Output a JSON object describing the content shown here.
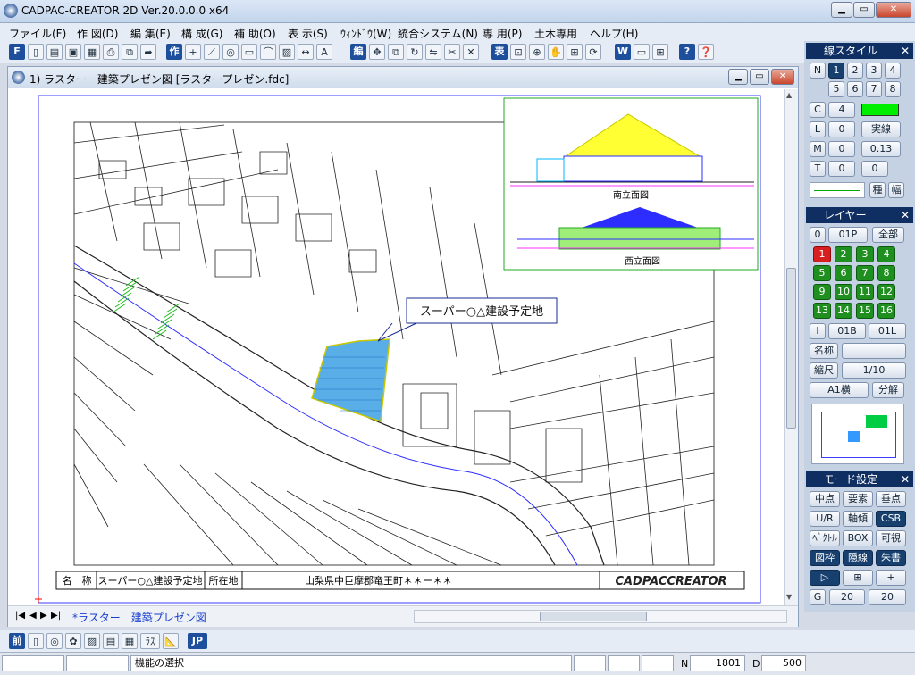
{
  "app": {
    "title": "CADPAC-CREATOR 2D Ver.20.0.0.0 x64"
  },
  "menu": [
    "ファイル(F)",
    "作 図(D)",
    "編 集(E)",
    "構 成(G)",
    "補 助(O)",
    "表 示(S)",
    "ｳｨﾝﾄﾞｳ(W)",
    "統合システム(N)",
    "専 用(P)",
    "土木専用",
    "ヘルプ(H)"
  ],
  "toolbar": {
    "btn_f": "F",
    "btn_saku": "作",
    "btn_hen": "編",
    "btn_hyo": "表",
    "btn_w": "W",
    "btn_help": "?"
  },
  "document": {
    "title": "1) ラスター　建築プレゼン図 [ラスタープレゼン.fdc]",
    "callout": "スーパー○△建設予定地",
    "elev_south": "南立面図",
    "elev_west": "西立面図",
    "table": {
      "label1": "名　称",
      "value1": "スーパー○△建設予定地",
      "label2": "所在地",
      "value2": "山梨県中巨摩郡竜王町＊＊ー＊＊"
    },
    "brand": "CADPACCREATOR",
    "tab": "*ラスター　建築プレゼン図"
  },
  "line_style": {
    "title": "線スタイル",
    "n_buttons": [
      "N",
      "1",
      "2",
      "3",
      "4",
      "5",
      "6",
      "7",
      "8"
    ],
    "c_label": "C",
    "c_value": "4",
    "l_label": "L",
    "l_value": "0",
    "l_type": "実線",
    "w_label": "M",
    "w_value": "0",
    "w_width": "0.13",
    "t_label": "T",
    "t_value": "0",
    "t_value2": "0",
    "btn_type": "種",
    "btn_width": "幅",
    "color_swatch": "#00ee00"
  },
  "layer": {
    "title": "レイヤー",
    "o_label": "0",
    "page": "01P",
    "all": "全部",
    "layers": [
      "1",
      "2",
      "3",
      "4",
      "5",
      "6",
      "7",
      "8",
      "9",
      "10",
      "11",
      "12",
      "13",
      "14",
      "15",
      "16"
    ],
    "i_label": "I",
    "block": "01B",
    "layer_cur": "01L",
    "name_label": "名称",
    "scale_label": "縮尺",
    "scale_value": "1/10",
    "paper": "A1横",
    "split": "分解"
  },
  "mode": {
    "title": "モード設定",
    "buttons": [
      "中点",
      "要素",
      "垂点",
      "U/R",
      "軸傾",
      "CSB",
      "ﾍﾞｸﾄﾙ",
      "BOX",
      "可視",
      "図枠",
      "隠線",
      "朱書"
    ],
    "g_label": "G",
    "g_value1": "20",
    "g_value2": "20"
  },
  "bottom_toolbar": {
    "btn_prev": "前",
    "btn_ras": "ﾗｽ",
    "btn_jp": "JP"
  },
  "status": {
    "message": "機能の選択",
    "n_label": "N",
    "n_value": "1801",
    "d_label": "D",
    "d_value": "500"
  }
}
